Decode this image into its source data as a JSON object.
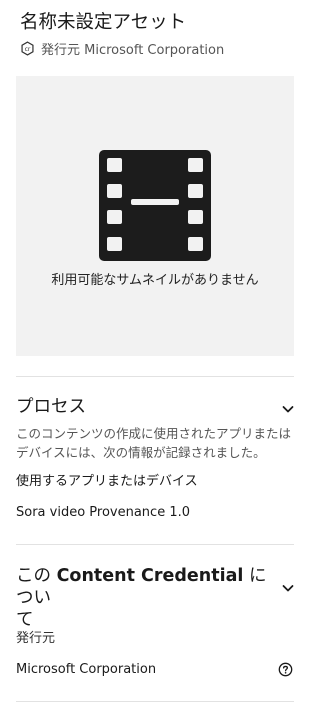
{
  "asset": {
    "title": "名称未設定アセット",
    "issuer_label": "発行元 Microsoft Corporation"
  },
  "preview": {
    "no_thumbnail_text": "利用可能なサムネイルがありません",
    "icon": "film-icon"
  },
  "process": {
    "heading": "プロセス",
    "description": "このコンテンツの作成に使用されたアプリまたはデバイスには、次の情報が記録されました。",
    "apps_label": "使用するアプリまたはデバイス",
    "apps_value": "Sora video Provenance 1.0"
  },
  "about": {
    "heading_part1": "この ",
    "heading_bold": "Content Credential",
    "heading_part2": " につい",
    "heading_line2": "て",
    "issuer_label": "発行元",
    "issuer_value": "Microsoft Corporation"
  },
  "icons": {
    "credential": "cr-icon",
    "chevron": "chevron-down-icon",
    "help": "help-circle-icon"
  }
}
